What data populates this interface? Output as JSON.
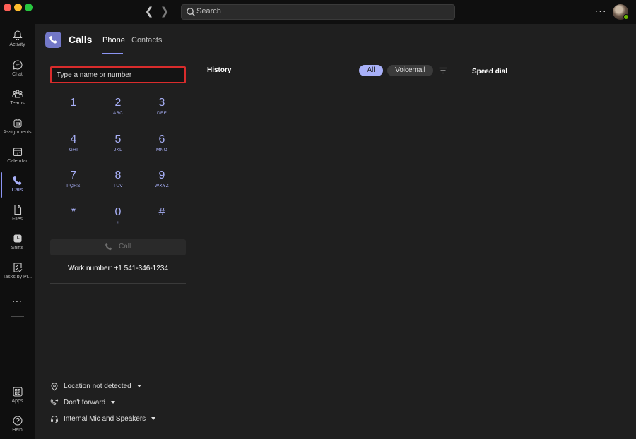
{
  "titlebar": {
    "search_placeholder": "Search"
  },
  "rail": {
    "items": [
      {
        "label": "Activity",
        "icon": "bell-icon"
      },
      {
        "label": "Chat",
        "icon": "chat-icon"
      },
      {
        "label": "Teams",
        "icon": "teams-icon"
      },
      {
        "label": "Assignments",
        "icon": "backpack-icon"
      },
      {
        "label": "Calendar",
        "icon": "calendar-icon"
      },
      {
        "label": "Calls",
        "icon": "phone-icon"
      },
      {
        "label": "Files",
        "icon": "file-icon"
      },
      {
        "label": "Shifts",
        "icon": "clock-icon"
      },
      {
        "label": "Tasks by Pl...",
        "icon": "tasks-icon"
      },
      {
        "label": "Apps",
        "icon": "apps-icon"
      },
      {
        "label": "Help",
        "icon": "help-icon"
      }
    ],
    "more_label": "...",
    "active": "Calls",
    "accent": "#8b94f3"
  },
  "header": {
    "title": "Calls",
    "tabs": [
      {
        "label": "Phone",
        "selected": true
      },
      {
        "label": "Contacts",
        "selected": false
      }
    ]
  },
  "dialpad": {
    "input_placeholder": "Type a name or number",
    "keys": [
      {
        "digit": "1",
        "letters": ""
      },
      {
        "digit": "2",
        "letters": "ABC"
      },
      {
        "digit": "3",
        "letters": "DEF"
      },
      {
        "digit": "4",
        "letters": "GHI"
      },
      {
        "digit": "5",
        "letters": "JKL"
      },
      {
        "digit": "6",
        "letters": "MNO"
      },
      {
        "digit": "7",
        "letters": "PQRS"
      },
      {
        "digit": "8",
        "letters": "TUV"
      },
      {
        "digit": "9",
        "letters": "WXYZ"
      },
      {
        "digit": "*",
        "letters": ""
      },
      {
        "digit": "0",
        "letters": "+"
      },
      {
        "digit": "#",
        "letters": ""
      }
    ],
    "call_label": "Call",
    "work_number": "Work number: +1 541-346-1234",
    "settings": {
      "location": "Location not detected",
      "forwarding": "Don't forward",
      "device": "Internal Mic and Speakers"
    },
    "input_border_color": "#d92c2c"
  },
  "history": {
    "title": "History",
    "filter_all": "All",
    "filter_voicemail": "Voicemail"
  },
  "speed_dial": {
    "title": "Speed dial"
  }
}
